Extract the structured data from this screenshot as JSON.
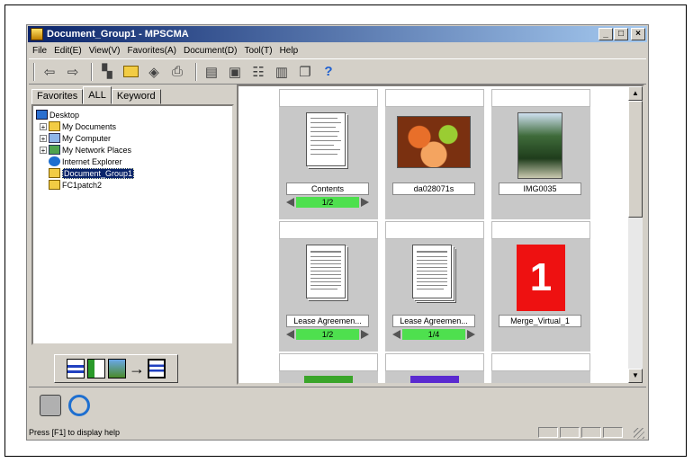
{
  "window": {
    "title": "Document_Group1 - MPSCMA",
    "controls": [
      "_",
      "□",
      "×"
    ]
  },
  "menu": [
    "File",
    "Edit(E)",
    "View(V)",
    "Favorites(A)",
    "Document(D)",
    "Tool(T)",
    "Help"
  ],
  "tabs": [
    {
      "label": "Favorites",
      "active": false
    },
    {
      "label": "ALL",
      "active": true
    },
    {
      "label": "Keyword",
      "active": false
    }
  ],
  "tree": [
    {
      "label": "Desktop",
      "icon": "desktop-icon",
      "selected": false
    },
    {
      "label": "My Documents",
      "icon": "folder-icon",
      "selected": false
    },
    {
      "label": "My Computer",
      "icon": "computer-icon",
      "selected": false
    },
    {
      "label": "My Network Places",
      "icon": "network-icon",
      "selected": false
    },
    {
      "label": "Internet Explorer",
      "icon": "internet-explorer-icon",
      "selected": false
    },
    {
      "label": "Document_Group1",
      "icon": "folder-icon",
      "selected": true
    },
    {
      "label": "FC1patch2",
      "icon": "folder-icon",
      "selected": false
    }
  ],
  "cards": [
    {
      "name": "Contents",
      "page": "1/2",
      "kind": "doc"
    },
    {
      "name": "da028071s",
      "page": "",
      "kind": "fruit-photo"
    },
    {
      "name": "IMG0035",
      "page": "",
      "kind": "palm-photo"
    },
    {
      "name": "Lease Agreemen...",
      "page": "1/2",
      "kind": "doc"
    },
    {
      "name": "Lease Agreemen...",
      "page": "1/4",
      "kind": "doc"
    },
    {
      "name": "Merge_Virtual_1",
      "page": "",
      "kind": "merge",
      "badge": "1"
    }
  ],
  "status": {
    "text": "Press [F1] to display help"
  },
  "colors": {
    "title_start": "#0a246a",
    "title_end": "#a6caf0",
    "pager_green": "#4ee04e",
    "merge_red": "#ee1111"
  }
}
